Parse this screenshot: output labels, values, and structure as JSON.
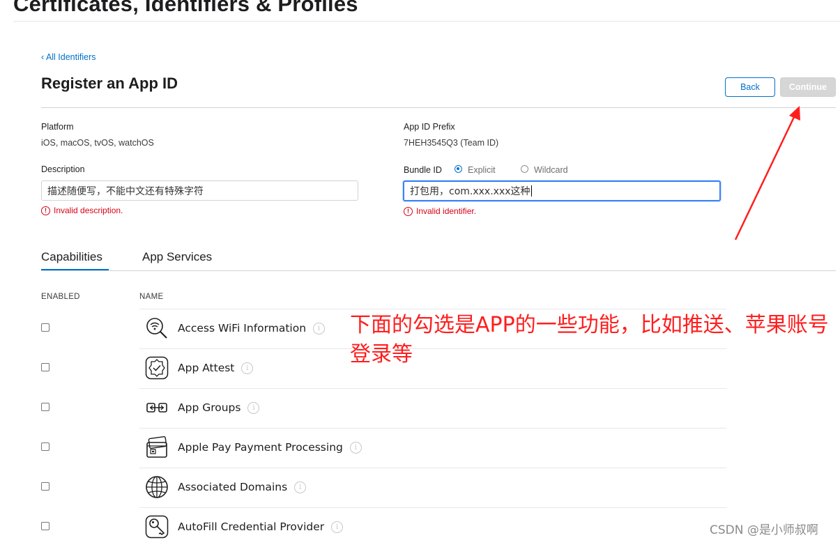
{
  "page": {
    "title": "Certificates, Identifiers & Profiles",
    "breadcrumb": "‹ All Identifiers",
    "heading": "Register an App ID"
  },
  "buttons": {
    "back": "Back",
    "continue": "Continue"
  },
  "form": {
    "platform_label": "Platform",
    "platform_value": "iOS, macOS, tvOS, watchOS",
    "prefix_label": "App ID Prefix",
    "prefix_value": "7HEH3545Q3 (Team ID)",
    "description_label": "Description",
    "description_value": "描述随便写，不能中文还有特殊字符",
    "description_error": "Invalid description.",
    "bundle_label": "Bundle ID",
    "bundle_option_explicit": "Explicit",
    "bundle_option_wildcard": "Wildcard",
    "bundle_selected": "Explicit",
    "bundle_value": "打包用，com.xxx.xxx这种",
    "bundle_error": "Invalid identifier."
  },
  "tabs": [
    {
      "label": "Capabilities",
      "active": true
    },
    {
      "label": "App Services",
      "active": false
    }
  ],
  "table": {
    "columns": [
      "ENABLED",
      "NAME"
    ],
    "rows": [
      {
        "name": "Access WiFi Information",
        "icon": "wifi-search-icon",
        "enabled": false
      },
      {
        "name": "App Attest",
        "icon": "badge-check-icon",
        "enabled": false
      },
      {
        "name": "App Groups",
        "icon": "app-groups-icon",
        "enabled": false
      },
      {
        "name": "Apple Pay Payment Processing",
        "icon": "wallet-cards-icon",
        "enabled": false
      },
      {
        "name": "Associated Domains",
        "icon": "globe-icon",
        "enabled": false
      },
      {
        "name": "AutoFill Credential Provider",
        "icon": "key-icon",
        "enabled": false
      }
    ]
  },
  "annotation": {
    "text": "下面的勾选是APP的一些功能，比如推送、苹果账号登录等",
    "color": "#ff1e1e"
  },
  "watermark": "CSDN @是小师叔啊",
  "colors": {
    "accent": "#0070c9",
    "error": "#d70015",
    "disabled_button": "#d6d6d6"
  }
}
